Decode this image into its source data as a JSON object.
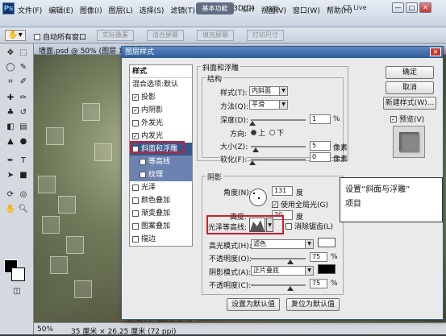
{
  "menubar": {
    "logo": "Ps",
    "items": [
      "文件(F)",
      "编辑(E)",
      "图像(I)",
      "图层(L)",
      "选择(S)",
      "滤镜(T)",
      "分析(A)",
      "3D(D)",
      "视图(V)",
      "窗口(W)",
      "帮助(H)"
    ],
    "workspace": "基本功能",
    "links": [
      "设计",
      "绘画"
    ],
    "cslive": "CS Live",
    "controls": [
      "—",
      "□",
      "✕"
    ]
  },
  "optbar": {
    "auto_select": "自动所有窗口",
    "buttons": [
      "实际像素",
      "适合屏幕",
      "填充屏幕",
      "打印尺寸"
    ]
  },
  "doc": {
    "tab": "墙面.psd @ 50% (图层 1",
    "zoom": "50%",
    "info": "35 厘米 × 26.25 厘米 (72 ppi)"
  },
  "dialog": {
    "title": "图层样式",
    "style_list": {
      "header": "样式",
      "blend": "混合选项:默认",
      "items": [
        {
          "label": "投影",
          "checked": true
        },
        {
          "label": "内阴影",
          "checked": true
        },
        {
          "label": "外发光",
          "checked": false
        },
        {
          "label": "内发光",
          "checked": true
        },
        {
          "label": "斜面和浮雕",
          "checked": true
        },
        {
          "label": "等高线",
          "checked": false
        },
        {
          "label": "纹理",
          "checked": false
        },
        {
          "label": "光泽",
          "checked": false
        },
        {
          "label": "颜色叠加",
          "checked": false
        },
        {
          "label": "渐变叠加",
          "checked": false
        },
        {
          "label": "图案叠加",
          "checked": false
        },
        {
          "label": "描边",
          "checked": false
        }
      ]
    },
    "bevel": {
      "group_title": "斜面和浮雕",
      "structure_title": "结构",
      "style_label": "样式(T):",
      "style_value": "内斜面",
      "technique_label": "方法(Q):",
      "technique_value": "平滑",
      "depth_label": "深度(D):",
      "depth_value": "1",
      "depth_unit": "%",
      "direction_label": "方向:",
      "direction_up": "上",
      "direction_down": "下",
      "size_label": "大小(Z):",
      "size_value": "5",
      "size_unit": "像素",
      "soften_label": "软化(F):",
      "soften_value": "0",
      "soften_unit": "像素"
    },
    "shading": {
      "title": "阴影",
      "angle_label": "角度(N):",
      "angle_value": "131",
      "angle_unit": "度",
      "global_light": "使用全局光(G)",
      "altitude_label": "高度:",
      "altitude_value": "30",
      "altitude_unit": "度",
      "gloss_label": "光泽等高线:",
      "antialias": "消除锯齿(L)",
      "highlight_mode_label": "高光模式(H):",
      "highlight_mode": "滤色",
      "opacity_label": "不透明度(O):",
      "highlight_opacity": "75",
      "shadow_mode_label": "阴影模式(A):",
      "shadow_mode": "正片叠底",
      "shadow_opacity_label": "不透明度(C):",
      "shadow_opacity": "75",
      "percent": "%"
    },
    "buttons": {
      "make_default": "设置为默认值",
      "reset_default": "复位为默认值",
      "ok": "确定",
      "cancel": "取消",
      "new_style": "新建样式(W)...",
      "preview": "预览(V)"
    }
  },
  "callout": {
    "line1": "设置“斜面与浮雕”",
    "line2": "项目"
  },
  "watermark": "腾龍視覺 WWW.LUVI.NET",
  "colors": {
    "accent": "#36578f",
    "highlight_box": "#d21b2b"
  }
}
